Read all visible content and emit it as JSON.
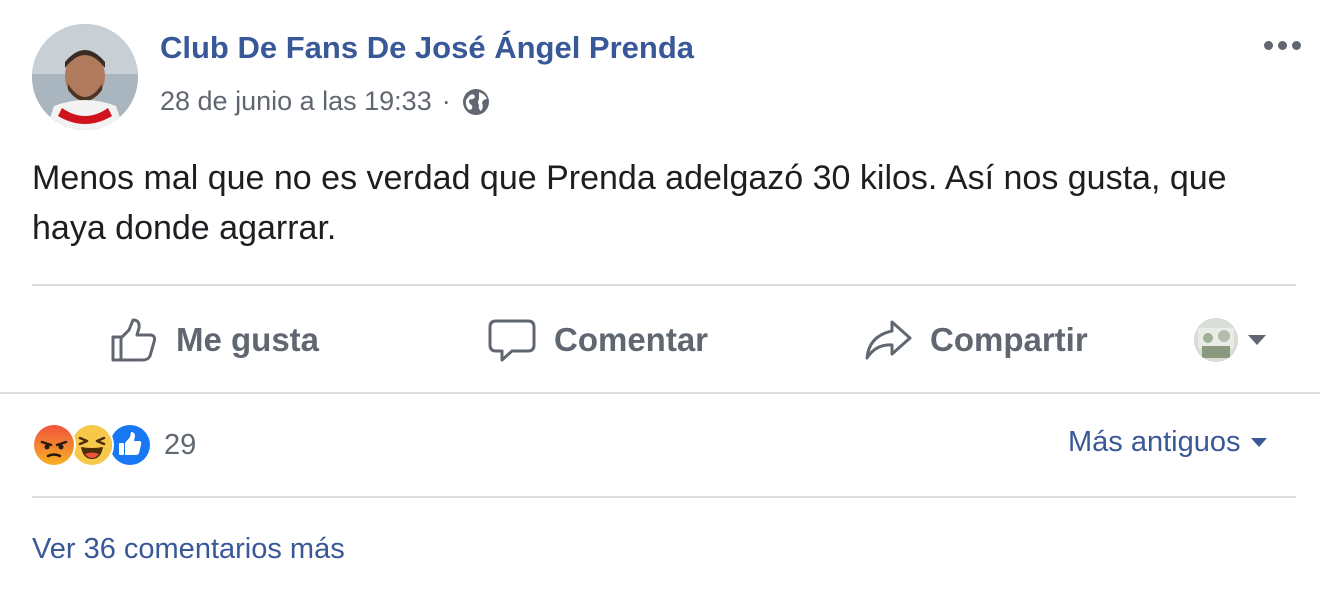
{
  "post": {
    "author": "Club De Fans De José Ángel Prenda",
    "date": "28 de junio a las 19:33",
    "separator": "·",
    "privacy_icon": "globe-icon",
    "menu_icon": "more-options-icon",
    "text": "Menos mal que no es verdad que Prenda adelgazó 30 kilos. Así nos gusta, que haya donde agarrar."
  },
  "actions": {
    "like_label": "Me gusta",
    "comment_label": "Comentar",
    "share_label": "Compartir",
    "like_icon": "thumbs-up-icon",
    "comment_icon": "comment-bubble-icon",
    "share_icon": "share-arrow-icon"
  },
  "reactions": {
    "types": [
      "angry",
      "haha",
      "like"
    ],
    "count": "29"
  },
  "comments": {
    "sort_label": "Más antiguos",
    "view_more": "Ver 36 comentarios más"
  },
  "colors": {
    "link": "#385898",
    "text": "#1c1e21",
    "secondary": "#606770",
    "divider": "#dadde1",
    "like_blue": "#1877f2",
    "angry_red": "#e9710f",
    "haha_yellow": "#f7b125"
  }
}
